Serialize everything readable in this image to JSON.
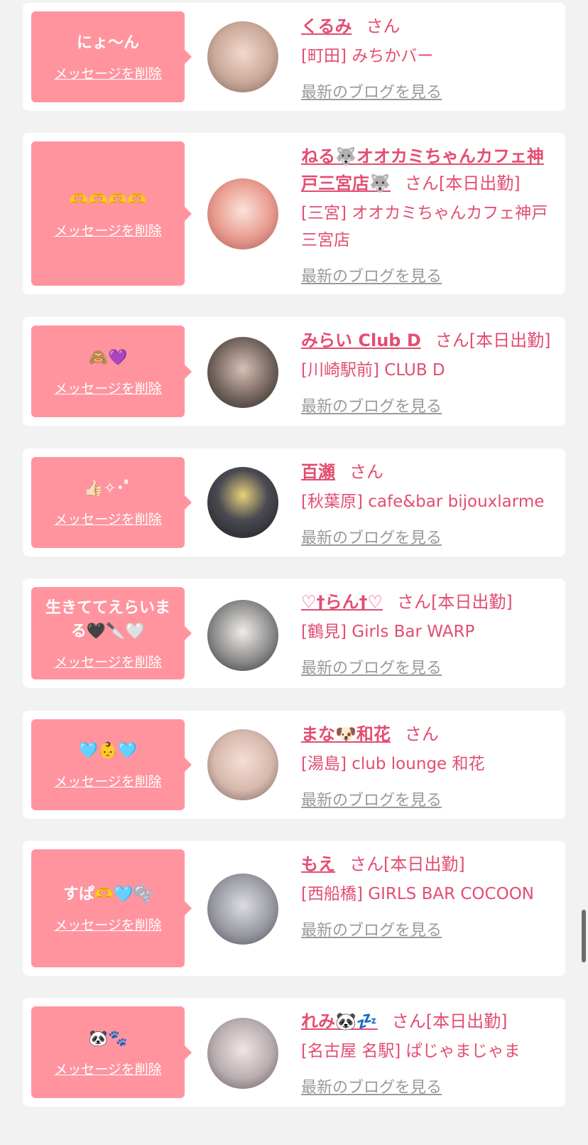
{
  "messages": [
    {
      "bubble": "にょ〜ん",
      "delete_label": "メッセージを削除",
      "name": "くるみ",
      "san": "さん",
      "work": "",
      "shop": "[町田] みちかバー",
      "blog_link": "最新のブログを見る"
    },
    {
      "bubble": "🫶🫶🫶🫶",
      "delete_label": "メッセージを削除",
      "name": "ねる🐺オオカミちゃんカフェ神戸三宮店🐺",
      "san": "さん",
      "work": "[本日出勤]",
      "shop": "[三宮] オオカミちゃんカフェ神戸三宮店",
      "blog_link": "最新のブログを見る"
    },
    {
      "bubble": "🙈💜",
      "delete_label": "メッセージを削除",
      "name": "みらい Club D",
      "san": "さん",
      "work": "[本日出勤]",
      "shop": "[川崎駅前] CLUB D",
      "blog_link": "最新のブログを見る"
    },
    {
      "bubble": "👍🏻✧･ﾟ",
      "delete_label": "メッセージを削除",
      "name": "百瀬",
      "san": "さん",
      "work": "",
      "shop": "[秋葉原] cafe&bar bijouxlarme",
      "blog_link": "最新のブログを見る"
    },
    {
      "bubble": "生きててえらいまる🖤🔪🤍",
      "delete_label": "メッセージを削除",
      "name": "♡†らん†♡",
      "san": "さん",
      "work": "[本日出勤]",
      "shop": "[鶴見] Girls Bar WARP",
      "blog_link": "最新のブログを見る"
    },
    {
      "bubble": "🩵👶🩵",
      "delete_label": "メッセージを削除",
      "name": "まな🐶和花",
      "san": "さん",
      "work": "",
      "shop": "[湯島] club lounge 和花",
      "blog_link": "最新のブログを見る"
    },
    {
      "bubble": "すぱ🫶🩵🫧",
      "delete_label": "メッセージを削除",
      "name": "もえ",
      "san": "さん",
      "work": "[本日出勤]",
      "shop": "[西船橋] GIRLS BAR COCOON",
      "blog_link": "最新のブログを見る"
    },
    {
      "bubble": "🐼🐾",
      "delete_label": "メッセージを削除",
      "name": "れみ🐼💤",
      "san": "さん",
      "work": "[本日出勤]",
      "shop": "[名古屋 名駅] ぱじゃまじゃま",
      "blog_link": "最新のブログを見る"
    }
  ],
  "avatar_colors": [
    "#c9a99a",
    "#e89a8e",
    "#6b5d58",
    "#2c2c34",
    "#8d8d8d",
    "#d6b9ad",
    "#9a9aa4",
    "#b8aeb0"
  ],
  "colors": {
    "accent": "#e34d71",
    "bubble": "#ff949f",
    "link_gray": "#9a9a9a"
  }
}
